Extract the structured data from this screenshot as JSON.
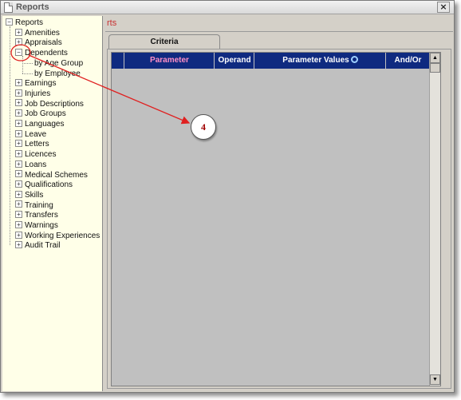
{
  "window": {
    "title": "Reports",
    "close_glyph": "×"
  },
  "tree": {
    "root": {
      "label": "Reports",
      "expander": "−"
    },
    "items": [
      {
        "label": "Amenities",
        "expander": "+"
      },
      {
        "label": "Appraisals",
        "expander": "+"
      },
      {
        "label": "Dependents",
        "expander": "−",
        "children": [
          {
            "label": "by Age Group"
          },
          {
            "label": "by Employee"
          }
        ]
      },
      {
        "label": "Earnings",
        "expander": "+"
      },
      {
        "label": "Injuries",
        "expander": "+"
      },
      {
        "label": "Job Descriptions",
        "expander": "+"
      },
      {
        "label": "Job Groups",
        "expander": "+"
      },
      {
        "label": "Languages",
        "expander": "+"
      },
      {
        "label": "Leave",
        "expander": "+"
      },
      {
        "label": "Letters",
        "expander": "+"
      },
      {
        "label": "Licences",
        "expander": "+"
      },
      {
        "label": "Loans",
        "expander": "+"
      },
      {
        "label": "Medical Schemes",
        "expander": "+"
      },
      {
        "label": "Qualifications",
        "expander": "+"
      },
      {
        "label": "Skills",
        "expander": "+"
      },
      {
        "label": "Training",
        "expander": "+"
      },
      {
        "label": "Transfers",
        "expander": "+"
      },
      {
        "label": "Warnings",
        "expander": "+"
      },
      {
        "label": "Working Experiences",
        "expander": "+"
      },
      {
        "label": "Audit Trail",
        "expander": "+"
      }
    ]
  },
  "panel": {
    "title_fragment": "rts"
  },
  "tabs": [
    {
      "label": "Criteria"
    }
  ],
  "grid": {
    "columns": [
      "Parameter",
      "Operand",
      "Parameter Values",
      "And/Or"
    ],
    "scroll_up": "▲",
    "scroll_down": "▼"
  },
  "annotation": {
    "callout_number": "4",
    "color": "#e02020"
  },
  "colors": {
    "tree_background": "#ffffe8",
    "grid_header": "#0f2a80",
    "parameter_header_text": "#ff8fc6"
  }
}
